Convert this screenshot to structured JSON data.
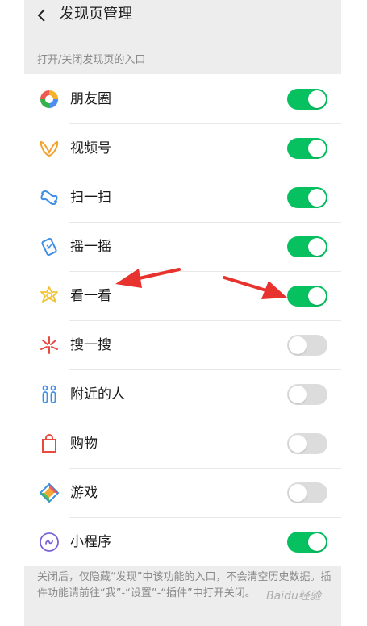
{
  "header": {
    "title": "发现页管理"
  },
  "section": {
    "label": "打开/关闭发现页的入口"
  },
  "items": [
    {
      "label": "朋友圈",
      "icon": "moments-icon",
      "on": true
    },
    {
      "label": "视频号",
      "icon": "channels-icon",
      "on": true
    },
    {
      "label": "扫一扫",
      "icon": "scan-icon",
      "on": true
    },
    {
      "label": "摇一摇",
      "icon": "shake-icon",
      "on": true
    },
    {
      "label": "看一看",
      "icon": "top-stories-icon",
      "on": true
    },
    {
      "label": "搜一搜",
      "icon": "search-icon",
      "on": false
    },
    {
      "label": "附近的人",
      "icon": "people-nearby-icon",
      "on": false
    },
    {
      "label": "购物",
      "icon": "shopping-bag-icon",
      "on": false
    },
    {
      "label": "游戏",
      "icon": "games-icon",
      "on": false
    },
    {
      "label": "小程序",
      "icon": "mini-programs-icon",
      "on": true
    }
  ],
  "footnote": "关闭后，仅隐藏“发现”中该功能的入口，不会清空历史数据。插件功能请前往“我”-“设置”-“插件”中打开关闭。",
  "watermark": "Baidu经验",
  "colors": {
    "toggle_on": "#07c160",
    "toggle_off": "#dcdcdc",
    "arrow": "#e8322e"
  }
}
